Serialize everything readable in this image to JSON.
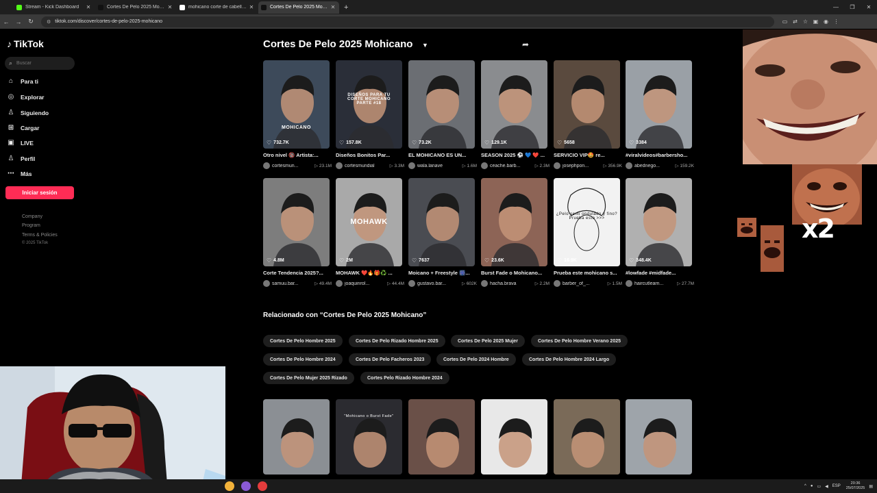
{
  "browser": {
    "tabs": [
      {
        "label": "Stream - Kick Dashboard",
        "color": "#53fc18"
      },
      {
        "label": "Cortes De Pelo 2025 Mohicano",
        "color": "#111111"
      },
      {
        "label": "mohicano corte de cabello - Ma",
        "color": "#ffffff"
      },
      {
        "label": "Cortes De Pelo 2025 Mohicano",
        "color": "#111111",
        "active": true
      }
    ],
    "url": "tiktok.com/discover/cortes-de-pelo-2025-mohicano"
  },
  "sidebar": {
    "logo": "TikTok",
    "search_placeholder": "Buscar",
    "items": [
      {
        "label": "Para ti",
        "icon": "home-icon"
      },
      {
        "label": "Explorar",
        "icon": "compass-icon"
      },
      {
        "label": "Siguiendo",
        "icon": "following-icon"
      },
      {
        "label": "Cargar",
        "icon": "upload-icon"
      },
      {
        "label": "LIVE",
        "icon": "live-icon"
      },
      {
        "label": "Perfil",
        "icon": "profile-icon"
      },
      {
        "label": "Más",
        "icon": "more-icon"
      }
    ],
    "login_label": "Iniciar sesión",
    "footer": [
      "Company",
      "Program",
      "Terms & Policies"
    ],
    "copyright": "© 2025 TikTok"
  },
  "main": {
    "title": "Cortes De Pelo 2025 Mohicano",
    "videos": [
      {
        "likes": "732.7K",
        "title": "Otro nivel 🔞 Artista:...",
        "author": "cortesmun...",
        "views": "23.1M",
        "overlay": "MOHICANO",
        "bg": "#3d4a5a"
      },
      {
        "likes": "157.8K",
        "title": "Diseños Bonitos Par...",
        "author": "cortesmundial",
        "views": "3.3M",
        "overlay": "DISEÑOS PARA TU CORTE MOHICANO PARTE #18",
        "bg": "#2a2e38"
      },
      {
        "likes": "73.2K",
        "title": "EL MOHICANO ES UN...",
        "author": "wala.lanave",
        "views": "1.6M",
        "overlay": "",
        "bg": "#6b6e73"
      },
      {
        "likes": "129.1K",
        "title": "SEASON 2025 ⚽ 💙 ❤️ ...",
        "author": "ceache.barb...",
        "views": "2.3M",
        "overlay": "",
        "bg": "#8a8c8f"
      },
      {
        "likes": "5658",
        "title": "SERVICIO VIP🤩 re...",
        "author": "josephpon...",
        "views": "356.9K",
        "overlay": "",
        "bg": "#5a4a3e"
      },
      {
        "likes": "3384",
        "title": "#viralvideos#barbersho...",
        "author": "abednego...",
        "views": "159.2K",
        "overlay": "",
        "bg": "#9aa0a6"
      },
      {
        "likes": "4.8M",
        "title": "Corte Tendencia 2025?...",
        "author": "samuu.bar...",
        "views": "49.4M",
        "overlay": "",
        "bg": "#7d7d7d"
      },
      {
        "likes": "2M",
        "title": "MOHAWK ❤️🔥🎁♻️ ...",
        "author": "joaquinrol...",
        "views": "44.4M",
        "overlay": "MOHAWK",
        "bg": "#a9a9a9"
      },
      {
        "likes": "7637",
        "title": "Moicano + Freestyle 🎆...",
        "author": "gustavo.bar...",
        "views": "602K",
        "overlay": "",
        "bg": "#4a4c52"
      },
      {
        "likes": "23.6K",
        "title": "Burst Fade o Mohicano...",
        "author": "hacha.brava",
        "views": "2.2M",
        "overlay": "",
        "bg": "#8d6456"
      },
      {
        "likes": "16.9K",
        "title": "Prueba este mohicano s...",
        "author": "barber_of_...",
        "views": "1.5M",
        "overlay": "¿Pelo semi ondulado y fino? Prueba esto >>>",
        "bg": "#f2f2f2"
      },
      {
        "likes": "348.4K",
        "title": "#lowfade #midfade...",
        "author": "haircutlearn...",
        "views": "27.7M",
        "overlay": "",
        "bg": "#b0b0b0"
      }
    ],
    "related_title": "Relacionado con “Cortes De Pelo 2025 Mohicano”",
    "chips": [
      "Cortes De Pelo Hombre 2025",
      "Cortes De Pelo Rizado Hombre 2025",
      "Cortes De Pelo 2025 Mujer",
      "Cortes De Pelo Hombre Verano 2025",
      "Cortes De Pelo Hombre 2024",
      "Cortes De Pelo Facheros 2023",
      "Cortes De Pelo 2024 Hombre",
      "Cortes De Pelo Hombre 2024 Largo",
      "Cortes De Pelo Mujer 2025 Rizado",
      "Cortes Pelo Rizado Hombre 2024"
    ],
    "bottom_videos": [
      {
        "overlay": "",
        "bg": "#8b8f94"
      },
      {
        "overlay": "\"Mohicano o Burst Fade\"",
        "bg": "#2b2b30"
      },
      {
        "overlay": "",
        "bg": "#6a5048"
      },
      {
        "overlay": "",
        "bg": "#e8e8e8"
      },
      {
        "overlay": "",
        "bg": "#7a6a58"
      },
      {
        "overlay": "",
        "bg": "#9ea4aa"
      }
    ]
  },
  "overlay": {
    "multiplier": "x2"
  },
  "taskbar": {
    "lang": "ESP",
    "time": "20:36",
    "date": "25/07/2025"
  }
}
